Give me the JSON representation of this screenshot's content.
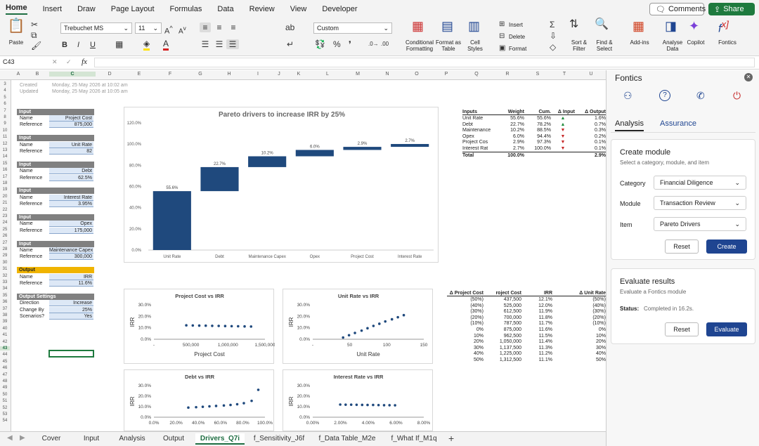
{
  "menu": {
    "tabs": [
      "Home",
      "Insert",
      "Draw",
      "Page Layout",
      "Formulas",
      "Data",
      "Review",
      "View",
      "Developer"
    ],
    "comments": "Comments",
    "share": "Share"
  },
  "ribbon": {
    "font_name": "Trebuchet MS",
    "font_size": "11",
    "number_format": "Custom",
    "paste": "Paste",
    "bold": "B",
    "italic": "I",
    "underline": "U",
    "insert": "Insert",
    "delete": "Delete",
    "format": "Format",
    "conditional_formatting": "Conditional Formatting",
    "format_as_table": "Format as Table",
    "cell_styles": "Cell Styles",
    "sort_filter": "Sort & Filter",
    "find_select": "Find & Select",
    "add_ins": "Add-ins",
    "analyse_data": "Analyse Data",
    "copilot": "Copilot",
    "fontics": "Fontics"
  },
  "formula_bar": {
    "cell_ref": "C43",
    "fx": "fx",
    "content": ""
  },
  "columns": [
    "A",
    "B",
    "C",
    "D",
    "E",
    "F",
    "G",
    "H",
    "I",
    "J",
    "K",
    "L",
    "M",
    "N",
    "O",
    "P",
    "Q",
    "R",
    "S",
    "T",
    "U"
  ],
  "rows": [
    "3",
    "4",
    "5",
    "6",
    "7",
    "8",
    "9",
    "10",
    "11",
    "12",
    "13",
    "14",
    "15",
    "16",
    "17",
    "18",
    "19",
    "20",
    "21",
    "22",
    "23",
    "24",
    "25",
    "26",
    "27",
    "28",
    "29",
    "30",
    "31",
    "32",
    "33",
    "34",
    "35",
    "36",
    "37",
    "38",
    "39",
    "40",
    "41",
    "42",
    "43",
    "44",
    "45",
    "46",
    "47",
    "48",
    "49",
    "50",
    "51",
    "52",
    "53",
    "54"
  ],
  "meta": {
    "created_label": "Created",
    "created_value": "Monday, 25 May 2026 at 10:02 am",
    "updated_label": "Updated",
    "updated_value": "Monday, 25 May 2026 at 10:05 am"
  },
  "inputs": [
    {
      "header": "Input",
      "name_label": "Name",
      "name": "Project Cost",
      "ref_label": "Reference",
      "ref": "875,000"
    },
    {
      "header": "Input",
      "name_label": "Name",
      "name": "Unit Rate",
      "ref_label": "Reference",
      "ref": "82"
    },
    {
      "header": "Input",
      "name_label": "Name",
      "name": "Debt",
      "ref_label": "Reference",
      "ref": "62.5%"
    },
    {
      "header": "Input",
      "name_label": "Name",
      "name": "Interest Rate",
      "ref_label": "Reference",
      "ref": "3.95%"
    },
    {
      "header": "Input",
      "name_label": "Name",
      "name": "Opex",
      "ref_label": "Reference",
      "ref": "175,000"
    },
    {
      "header": "Input",
      "name_label": "Name",
      "name": "Maintenance Capex",
      "ref_label": "Reference",
      "ref": "300,000"
    }
  ],
  "output": {
    "header": "Output",
    "name_label": "Name",
    "name": "IRR",
    "ref_label": "Reference",
    "ref": "11.6%"
  },
  "settings": {
    "header": "Output Settings",
    "rows": [
      {
        "label": "Direction",
        "value": "Increase"
      },
      {
        "label": "Change By",
        "value": "25%"
      },
      {
        "label": "Scenarios?",
        "value": "Yes"
      }
    ]
  },
  "summary_table": {
    "headers": [
      "Inputs",
      "Weight",
      "Cum.",
      "Δ Input",
      "Δ Output"
    ],
    "rows": [
      {
        "name": "Unit Rate",
        "weight": "55.6%",
        "cum": "55.6%",
        "arrow": "▲",
        "out": "1.6%"
      },
      {
        "name": "Debt",
        "weight": "22.7%",
        "cum": "78.2%",
        "arrow": "▲",
        "out": "0.7%"
      },
      {
        "name": "Maintenance",
        "weight": "10.2%",
        "cum": "88.5%",
        "arrow": "▼",
        "out": "0.3%"
      },
      {
        "name": "Opex",
        "weight": "6.0%",
        "cum": "94.4%",
        "arrow": "▼",
        "out": "0.2%"
      },
      {
        "name": "Project Cos",
        "weight": "2.9%",
        "cum": "97.3%",
        "arrow": "▼",
        "out": "0.1%"
      },
      {
        "name": "Interest Rat",
        "weight": "2.7%",
        "cum": "100.0%",
        "arrow": "▼",
        "out": "0.1%"
      }
    ],
    "total": {
      "name": "Total",
      "weight": "100.0%",
      "out": "2.9%"
    },
    "colors": {
      "up": "#1e8a3c",
      "down": "#c62828"
    }
  },
  "sens_table": {
    "headers": [
      "Δ Project Cost",
      "roject Cost",
      "IRR",
      "Δ Unit Rate"
    ],
    "rows": [
      [
        "(50%)",
        "437,500",
        "12.1%",
        "(50%)"
      ],
      [
        "(40%)",
        "525,000",
        "12.0%",
        "(40%)"
      ],
      [
        "(30%)",
        "612,500",
        "11.9%",
        "(30%)"
      ],
      [
        "(20%)",
        "700,000",
        "11.8%",
        "(20%)"
      ],
      [
        "(10%)",
        "787,500",
        "11.7%",
        "(10%)"
      ],
      [
        "0%",
        "875,000",
        "11.6%",
        "0%"
      ],
      [
        "10%",
        "962,500",
        "11.5%",
        "10%"
      ],
      [
        "20%",
        "1,050,000",
        "11.4%",
        "20%"
      ],
      [
        "30%",
        "1,137,500",
        "11.3%",
        "30%"
      ],
      [
        "40%",
        "1,225,000",
        "11.2%",
        "40%"
      ],
      [
        "50%",
        "1,312,500",
        "11.1%",
        "50%"
      ]
    ]
  },
  "chart_data": [
    {
      "type": "bar",
      "title": "Pareto drivers to increase IRR by 25%",
      "categories": [
        "Unit Rate",
        "Debt",
        "Maintenance Capex",
        "Opex",
        "Project Cost",
        "Interest Rate"
      ],
      "values": [
        55.6,
        22.7,
        10.2,
        6.0,
        2.9,
        2.7
      ],
      "labels": [
        "55.6%",
        "22.7%",
        "10.2%",
        "6.0%",
        "2.9%",
        "2.7%"
      ],
      "ylim": [
        0,
        120
      ],
      "yticks": [
        "0.0%",
        "20.0%",
        "40.0%",
        "60.0%",
        "80.0%",
        "100.0%",
        "120.0%"
      ],
      "color": "#1f497d"
    },
    {
      "type": "scatter",
      "title": "Project Cost vs IRR",
      "xlabel": "Project Cost",
      "ylabel": "IRR",
      "xlim": [
        0,
        1500000
      ],
      "ylim": [
        0,
        30
      ],
      "xticks": [
        "-",
        "500,000",
        "1,000,000",
        "1,500,000"
      ],
      "yticks": [
        "0.0%",
        "10.0%",
        "20.0%",
        "30.0%"
      ],
      "x": [
        437500,
        525000,
        612500,
        700000,
        787500,
        875000,
        962500,
        1050000,
        1137500,
        1225000,
        1312500
      ],
      "y": [
        12.1,
        12.0,
        11.9,
        11.8,
        11.7,
        11.6,
        11.5,
        11.4,
        11.3,
        11.2,
        11.1
      ]
    },
    {
      "type": "scatter",
      "title": "Unit Rate vs IRR",
      "xlabel": "Unit Rate",
      "ylabel": "IRR",
      "xlim": [
        0,
        150
      ],
      "ylim": [
        0,
        30
      ],
      "xticks": [
        "-",
        "50",
        "100",
        "150"
      ],
      "yticks": [
        "0.0%",
        "10.0%",
        "20.0%",
        "30.0%"
      ],
      "x": [
        41,
        49,
        57,
        66,
        74,
        82,
        90,
        98,
        107,
        115,
        123
      ],
      "y": [
        1.5,
        3.5,
        5.5,
        7.5,
        9.6,
        11.6,
        13.5,
        15.5,
        17.4,
        19.2,
        21
      ]
    },
    {
      "type": "scatter",
      "title": "Debt vs IRR",
      "xlabel": "",
      "ylabel": "IRR",
      "xlim": [
        0,
        100
      ],
      "ylim": [
        0,
        30
      ],
      "xticks": [
        "0.0%",
        "20.0%",
        "40.0%",
        "60.0%",
        "80.0%",
        "100.0%"
      ],
      "yticks": [
        "0.0%",
        "10.0%",
        "20.0%",
        "30.0%"
      ],
      "x": [
        31,
        38,
        44,
        50,
        56,
        63,
        69,
        75,
        81,
        88,
        94
      ],
      "y": [
        9.1,
        9.5,
        9.9,
        10.3,
        10.7,
        11.1,
        11.6,
        12.3,
        13.3,
        15.5,
        26
      ]
    },
    {
      "type": "scatter",
      "title": "Interest Rate vs IRR",
      "xlabel": "",
      "ylabel": "IRR",
      "xlim": [
        0,
        8
      ],
      "ylim": [
        0,
        30
      ],
      "xticks": [
        "0.00%",
        "2.00%",
        "4.00%",
        "6.00%",
        "8.00%"
      ],
      "yticks": [
        "0.0%",
        "10.0%",
        "20.0%",
        "30.0%"
      ],
      "x": [
        1.98,
        2.37,
        2.77,
        3.16,
        3.56,
        3.95,
        4.35,
        4.74,
        5.14,
        5.53,
        5.93
      ],
      "y": [
        12.0,
        11.9,
        11.9,
        11.8,
        11.7,
        11.6,
        11.6,
        11.5,
        11.4,
        11.4,
        11.3
      ]
    }
  ],
  "sheet_tabs": [
    "Cover",
    "Input",
    "Analysis",
    "Output",
    "Drivers_Q7i",
    "f_Sensitivity_J6f",
    "f_Data Table_M2e",
    "f_What If_M1q"
  ],
  "active_sheet": "Drivers_Q7i",
  "pane": {
    "title": "Fontics",
    "tabs": [
      "Analysis",
      "Assurance"
    ],
    "create": {
      "title": "Create module",
      "subtitle": "Select a category, module, and item",
      "category_label": "Category",
      "category": "Financial Diligence",
      "module_label": "Module",
      "module": "Transaction Review",
      "item_label": "Item",
      "item": "Pareto Drivers",
      "reset": "Reset",
      "create": "Create"
    },
    "evaluate": {
      "title": "Evaluate results",
      "subtitle": "Evaluate a Fontics module",
      "status_label": "Status:",
      "status": "Completed in 16.2s.",
      "reset": "Reset",
      "evaluate": "Evaluate"
    }
  },
  "colors": {
    "accent": "#1e6e42",
    "primary_btn": "#1f4591",
    "output_header": "#f0b400",
    "input_header": "#808080",
    "bar": "#1f497d"
  }
}
